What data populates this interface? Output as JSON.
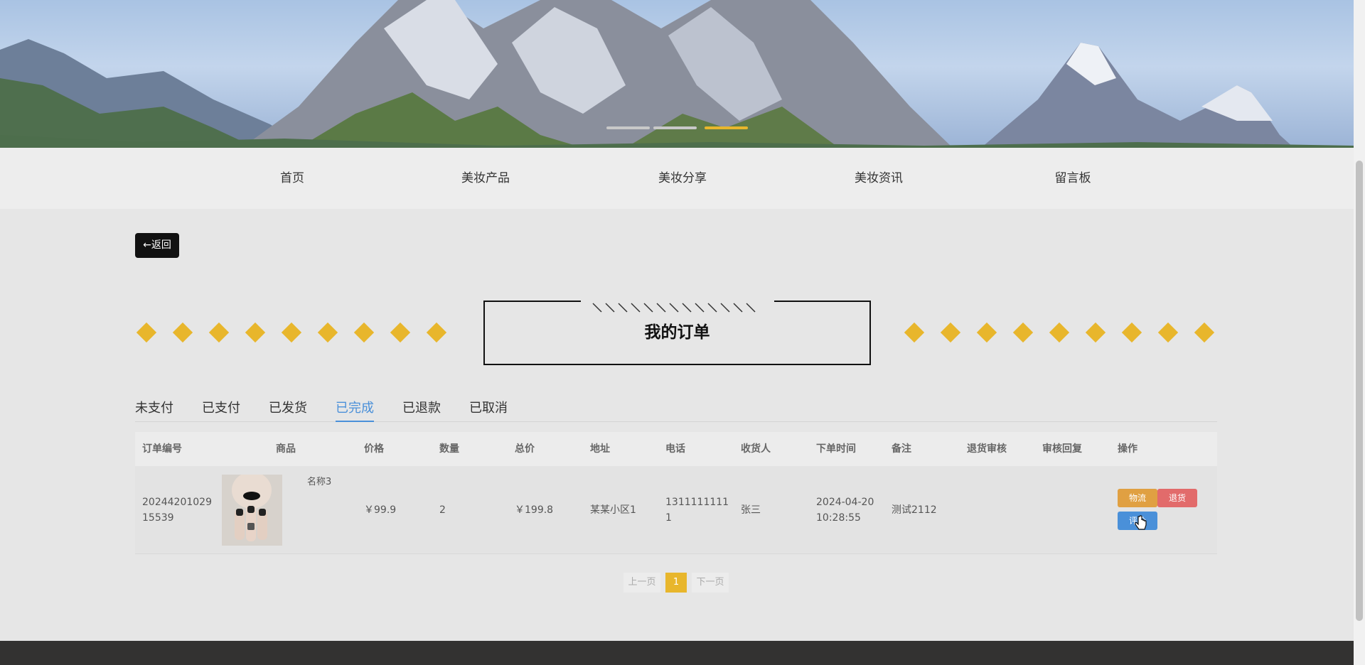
{
  "nav": {
    "items": [
      "首页",
      "美妆产品",
      "美妆分享",
      "美妆资讯",
      "留言板"
    ]
  },
  "back_label": "←返回",
  "title": "我的订单",
  "tabs": {
    "items": [
      "未支付",
      "已支付",
      "已发货",
      "已完成",
      "已退款",
      "已取消"
    ],
    "active": "已完成"
  },
  "table": {
    "headers": [
      "订单编号",
      "商品",
      "价格",
      "数量",
      "总价",
      "地址",
      "电话",
      "收货人",
      "下单时间",
      "备注",
      "退货审核",
      "审核回复",
      "操作"
    ],
    "rows": [
      {
        "order_no": "20244201029 15539",
        "order_no_line1": "20244201029",
        "order_no_line2": "15539",
        "product_name": "名称3",
        "price": "￥99.9",
        "quantity": "2",
        "total": "￥199.8",
        "address": "某某小区1",
        "phone_line1": "1311111111",
        "phone_line2": "1",
        "receiver": "张三",
        "date_line1": "2024-04-20",
        "date_line2": "10:28:55",
        "remark": "测试2112",
        "return_review": "",
        "review_reply": "",
        "actions": [
          "物流",
          "退货",
          "评价"
        ]
      }
    ]
  },
  "pagination": {
    "prev": "上一页",
    "current": "1",
    "next": "下一页"
  },
  "colors": {
    "accent": "#e8b62c",
    "tab_active": "#4a90d9",
    "logistics_btn": "#e0a042",
    "return_btn": "#e26b6b",
    "review_btn": "#4a90d9",
    "footer": "#333231"
  },
  "carousel": {
    "slides": 3,
    "active_index": 2
  }
}
